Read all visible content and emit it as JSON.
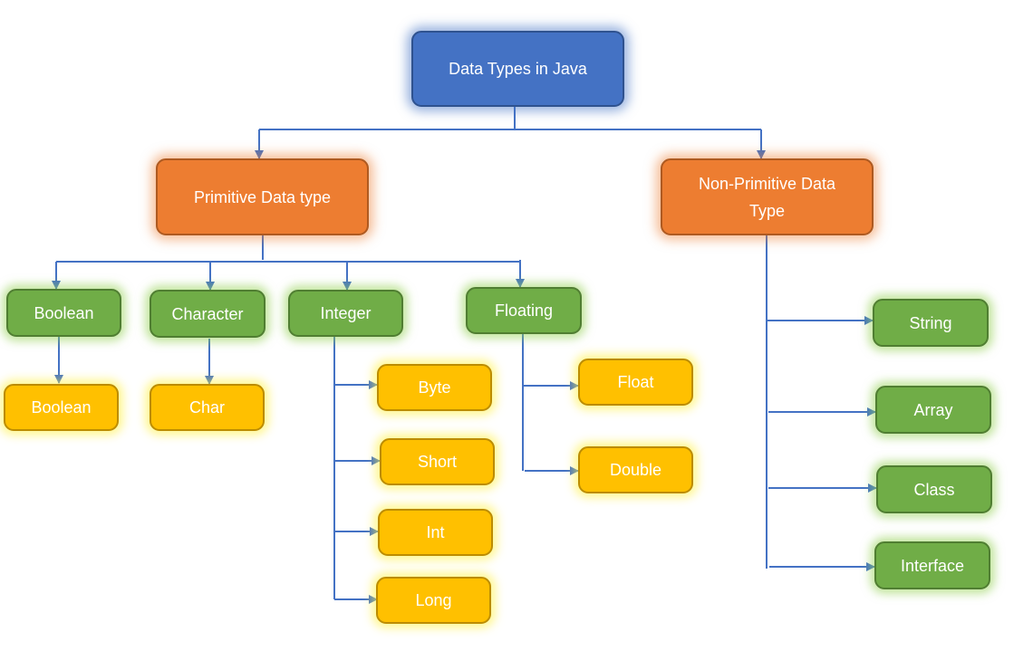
{
  "title": "Data Types in Java",
  "colors": {
    "root": "#4472c4",
    "category": "#ed7d31",
    "type_group": "#70ad47",
    "leaf": "#ffc000",
    "connector": "#4472c4"
  },
  "nodes": {
    "root": "Data Types in Java",
    "primitive": "Primitive Data type",
    "non_primitive": "Non-Primitive Data Type",
    "boolean_group": "Boolean",
    "character_group": "Character",
    "integer_group": "Integer",
    "floating_group": "Floating",
    "boolean_leaf": "Boolean",
    "char_leaf": "Char",
    "byte_leaf": "Byte",
    "short_leaf": "Short",
    "int_leaf": "Int",
    "long_leaf": "Long",
    "float_leaf": "Float",
    "double_leaf": "Double",
    "string_node": "String",
    "array_node": "Array",
    "class_node": "Class",
    "interface_node": "Interface"
  },
  "edges": [
    [
      "root",
      "primitive"
    ],
    [
      "root",
      "non_primitive"
    ],
    [
      "primitive",
      "boolean_group"
    ],
    [
      "primitive",
      "character_group"
    ],
    [
      "primitive",
      "integer_group"
    ],
    [
      "primitive",
      "floating_group"
    ],
    [
      "boolean_group",
      "boolean_leaf"
    ],
    [
      "character_group",
      "char_leaf"
    ],
    [
      "integer_group",
      "byte_leaf"
    ],
    [
      "integer_group",
      "short_leaf"
    ],
    [
      "integer_group",
      "int_leaf"
    ],
    [
      "integer_group",
      "long_leaf"
    ],
    [
      "floating_group",
      "float_leaf"
    ],
    [
      "floating_group",
      "double_leaf"
    ],
    [
      "non_primitive",
      "string_node"
    ],
    [
      "non_primitive",
      "array_node"
    ],
    [
      "non_primitive",
      "class_node"
    ],
    [
      "non_primitive",
      "interface_node"
    ]
  ]
}
